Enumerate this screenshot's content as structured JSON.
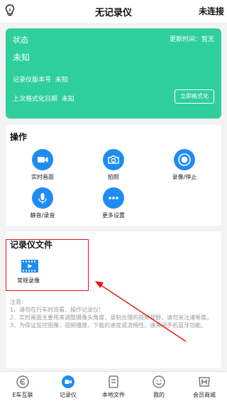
{
  "header": {
    "title": "无记录仪",
    "connection": "未连接",
    "left_icon": "lightbulb-icon"
  },
  "status": {
    "title": "状态",
    "update_label": "更新时间：",
    "update_value": "暂无",
    "value": "未知",
    "version_label": "记录仪版本号",
    "version_value": "未知",
    "format_label": "上次格式化日期",
    "format_value": "未知",
    "format_button": "立即格式化",
    "color": "#2fcf9c"
  },
  "operations": {
    "title": "操作",
    "items": [
      {
        "label": "实时画面",
        "icon": "video-camera-icon"
      },
      {
        "label": "拍照",
        "icon": "camera-icon"
      },
      {
        "label": "录像/停止",
        "icon": "record-icon"
      },
      {
        "label": "静音/录音",
        "icon": "microphone-icon"
      },
      {
        "label": "更多设置",
        "icon": "more-icon"
      }
    ],
    "icon_color": "#1f8cf2"
  },
  "files": {
    "title": "记录仪文件",
    "items": [
      {
        "label": "常规录像",
        "icon": "film-icon"
      }
    ],
    "notice": {
      "title": "注意:",
      "line1": "1、请勿在行车时观看、操作记录仪!",
      "line2": "2、实时画面主要用来调整摄像头角度，录制合理的视频视野，请勿关注清晰度。",
      "line3": "3、为保证监控图像，视频播放，下载的速度或流畅性，请关闭手机蓝牙功能。"
    }
  },
  "tabbar": {
    "items": [
      {
        "label": "E车互联",
        "icon": "e-car-icon",
        "active": false
      },
      {
        "label": "记录仪",
        "icon": "recorder-icon",
        "active": true
      },
      {
        "label": "本地文件",
        "icon": "local-files-icon",
        "active": false
      },
      {
        "label": "我的",
        "icon": "smiley-icon",
        "active": false
      },
      {
        "label": "会员商城",
        "icon": "honda-icon",
        "active": false
      }
    ],
    "active_color": "#1f8cf2"
  },
  "annotation": {
    "highlight_color": "#ee1111"
  }
}
